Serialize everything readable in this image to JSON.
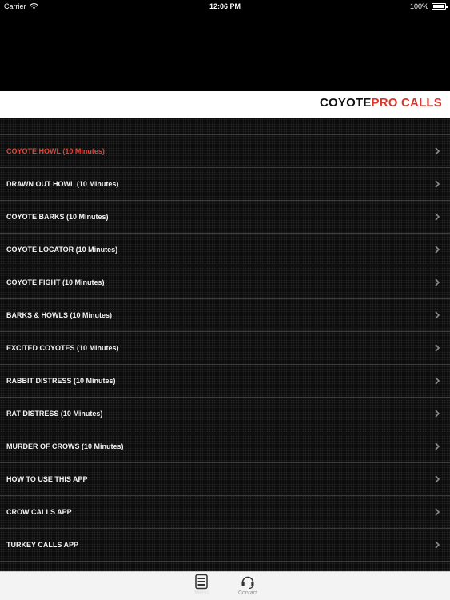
{
  "status_bar": {
    "carrier": "Carrier",
    "time": "12:06 PM",
    "battery": "100%"
  },
  "header": {
    "title_part1": "COYOTE",
    "title_part2": "PRO CALLS",
    "title_part2_color": "#d8372d"
  },
  "menu": {
    "items": [
      {
        "label": "COYOTE HOWL (10 Minutes)",
        "selected": true
      },
      {
        "label": "DRAWN OUT HOWL (10 Minutes)"
      },
      {
        "label": "COYOTE BARKS (10 Minutes)"
      },
      {
        "label": "COYOTE LOCATOR (10 Minutes)"
      },
      {
        "label": "COYOTE FIGHT (10 Minutes)"
      },
      {
        "label": "BARKS & HOWLS (10 Minutes)"
      },
      {
        "label": "EXCITED COYOTES (10 Minutes)"
      },
      {
        "label": "RABBIT DISTRESS (10 Minutes)"
      },
      {
        "label": "RAT DISTRESS (10 Minutes)"
      },
      {
        "label": "MURDER OF CROWS (10 Minutes)"
      },
      {
        "label": "HOW TO USE THIS APP"
      },
      {
        "label": "CROW CALLS APP"
      },
      {
        "label": "TURKEY CALLS APP"
      }
    ]
  },
  "tab_bar": {
    "tabs": [
      {
        "label": "Menu",
        "icon": "menu-list-icon",
        "active": true
      },
      {
        "label": "Contact",
        "icon": "headset-icon",
        "active": false
      }
    ]
  },
  "colors": {
    "accent": "#d8372d",
    "list_background": "#0d0d0d"
  }
}
